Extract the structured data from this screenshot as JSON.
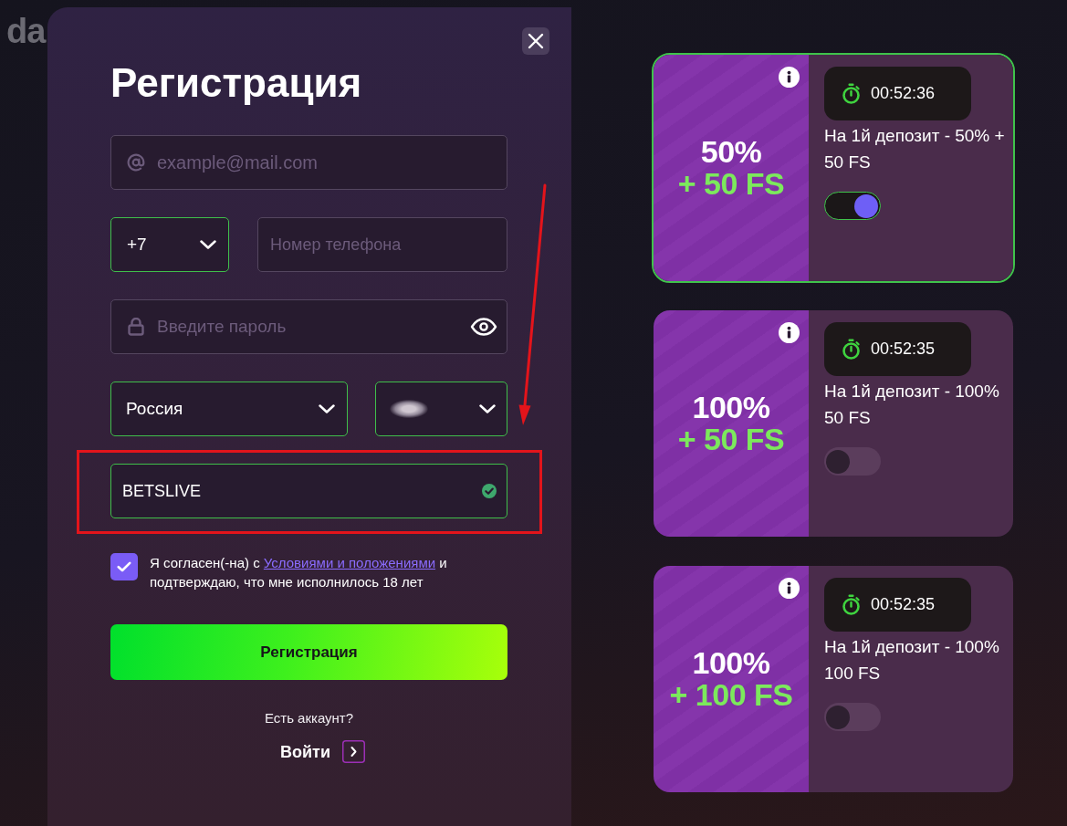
{
  "logo": {
    "text": "da"
  },
  "registration": {
    "title": "Регистрация",
    "email": {
      "placeholder": "example@mail.com",
      "valid": false
    },
    "phone_code": {
      "value": "+7",
      "valid": true
    },
    "phone_number": {
      "placeholder": "Номер телефона",
      "valid": false
    },
    "password": {
      "placeholder": "Введите пароль",
      "valid": false
    },
    "country": {
      "value": "Россия",
      "valid": true
    },
    "currency": {
      "valid": true
    },
    "promo_code": {
      "value": "BETSLIVE",
      "valid": true
    },
    "terms": {
      "checked": true,
      "text_before": "Я согласен(-на) с",
      "link": "Условиями и положениями",
      "text_after": "и подтверждаю, что мне исполнилось 18 лет"
    },
    "submit_button": "Регистрация",
    "login_prompt": "Есть аккаунт?",
    "login_link": "Войти"
  },
  "bonuses": [
    {
      "selected": true,
      "percent": "50%",
      "spins": "+ 50 FS",
      "timer": "00:52:36",
      "description": [
        "На 1й депозит - 50% +",
        "50 FS"
      ],
      "on": true
    },
    {
      "selected": false,
      "percent": "100%",
      "spins": "+ 50 FS",
      "timer": "00:52:35",
      "description": [
        "На 1й депозит - 100%",
        "50 FS"
      ],
      "on": false
    },
    {
      "selected": false,
      "percent": "100%",
      "spins": "+ 100 FS",
      "timer": "00:52:35",
      "description": [
        "На 1й депозит - 100%",
        "100 FS"
      ],
      "on": false
    }
  ]
}
